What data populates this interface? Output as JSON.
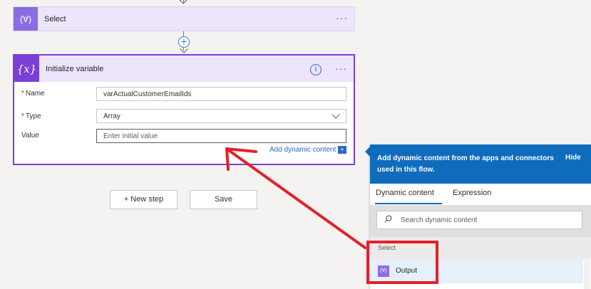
{
  "select_card": {
    "title": "Select",
    "icon": "{∀}"
  },
  "init_card": {
    "title": "Initialize variable",
    "icon": "{x}",
    "info_glyph": "i",
    "fields": {
      "name": {
        "label": "Name",
        "value": "varActualCustomerEmailIds",
        "required": true
      },
      "type": {
        "label": "Type",
        "value": "Array",
        "required": true
      },
      "value": {
        "label": "Value",
        "placeholder": "Enter initial value",
        "required": false
      }
    },
    "add_dynamic_label": "Add dynamic content",
    "add_dynamic_glyph": "+"
  },
  "buttons": {
    "new_step": "+ New step",
    "save": "Save"
  },
  "dynamic_panel": {
    "header": "Add dynamic content from the apps and connectors used in this flow.",
    "hide": "Hide",
    "tabs": [
      "Dynamic content",
      "Expression"
    ],
    "active_tab": "Dynamic content",
    "search_placeholder": "Search dynamic content",
    "section": "Select",
    "items": [
      {
        "label": "Output",
        "icon": "{∀}"
      }
    ]
  },
  "colors": {
    "accent": "#7b3fd6",
    "select_icon": "#8a6ce3",
    "panel_header": "#0f6cbd",
    "annotation": "#e4202a",
    "link": "#2b68c5"
  }
}
